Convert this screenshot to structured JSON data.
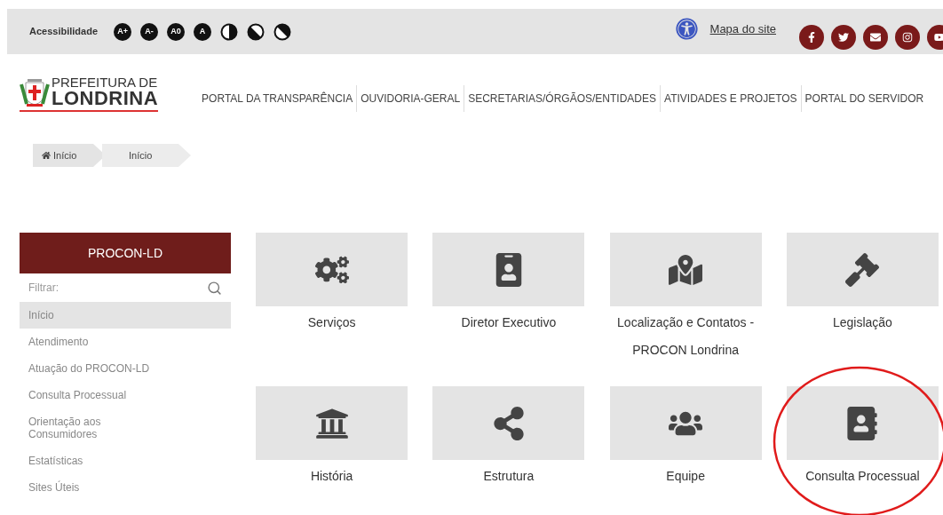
{
  "top_bar": {
    "accessibility_label": "Acessibilidade",
    "font_buttons": [
      "A+",
      "A-",
      "A0",
      "A"
    ],
    "site_map_link": "Mapa do site"
  },
  "logo": {
    "line_1": "PREFEITURA DE",
    "line_2": "LONDRINA"
  },
  "nav": [
    "PORTAL DA TRANSPARÊNCIA",
    "OUVIDORIA-GERAL",
    "SECRETARIAS/ÓRGÃOS/ENTIDADES",
    "ATIVIDADES E PROJETOS",
    "PORTAL DO SERVIDOR"
  ],
  "breadcrumb": [
    "Início",
    "Início"
  ],
  "sidebar": {
    "title": "PROCON-LD",
    "filter_placeholder": "Filtrar:",
    "items": [
      {
        "label": "Início",
        "selected": true
      },
      {
        "label": "Atendimento",
        "selected": false
      },
      {
        "label": "Atuação do PROCON-LD",
        "selected": false
      },
      {
        "label": "Consulta Processual",
        "selected": false
      },
      {
        "label": "Orientação aos Consumidores",
        "selected": false
      },
      {
        "label": "Estatísticas",
        "selected": false
      },
      {
        "label": "Sites Úteis",
        "selected": false
      }
    ]
  },
  "tiles": [
    {
      "label": "Serviços",
      "highlighted": false
    },
    {
      "label": "Diretor Executivo",
      "highlighted": false
    },
    {
      "label": "Localização e Contatos - PROCON Londrina",
      "highlighted": false
    },
    {
      "label": "Legislação",
      "highlighted": false
    },
    {
      "label": "História",
      "highlighted": false
    },
    {
      "label": "Estrutura",
      "highlighted": false
    },
    {
      "label": "Equipe",
      "highlighted": false
    },
    {
      "label": "Consulta Processual",
      "highlighted": true
    }
  ]
}
